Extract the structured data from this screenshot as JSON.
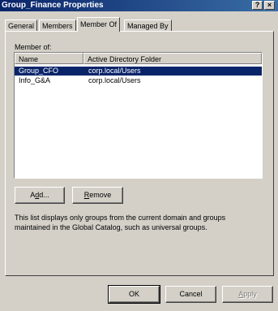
{
  "window": {
    "title": "Group_Finance Properties",
    "help_button": "?",
    "close_button": "×"
  },
  "tabs": [
    {
      "label": "General"
    },
    {
      "label": "Members"
    },
    {
      "label": "Member Of"
    },
    {
      "label": "Managed By"
    }
  ],
  "member_of": {
    "section_label": "Member of:",
    "columns": [
      "Name",
      "Active Directory Folder"
    ],
    "rows": [
      {
        "name": "Group_CFO",
        "folder": "corp.local/Users",
        "selected": true
      },
      {
        "name": "Info_G&A",
        "folder": "corp.local/Users",
        "selected": false
      }
    ],
    "add_button": {
      "pre": "A",
      "accel": "d",
      "post": "d..."
    },
    "remove_button": {
      "pre": "",
      "accel": "R",
      "post": "emove"
    },
    "description": "This list displays only groups from the current domain and groups maintained in the Global Catalog, such as universal groups."
  },
  "footer": {
    "ok_label": "OK",
    "cancel_label": "Cancel",
    "apply_button": {
      "pre": "",
      "accel": "A",
      "post": "pply"
    }
  },
  "colors": {
    "titlebar_start": "#0a246a",
    "titlebar_end": "#3a6ea5",
    "selection": "#0a246a",
    "dialog_face": "#d4d0c8"
  }
}
